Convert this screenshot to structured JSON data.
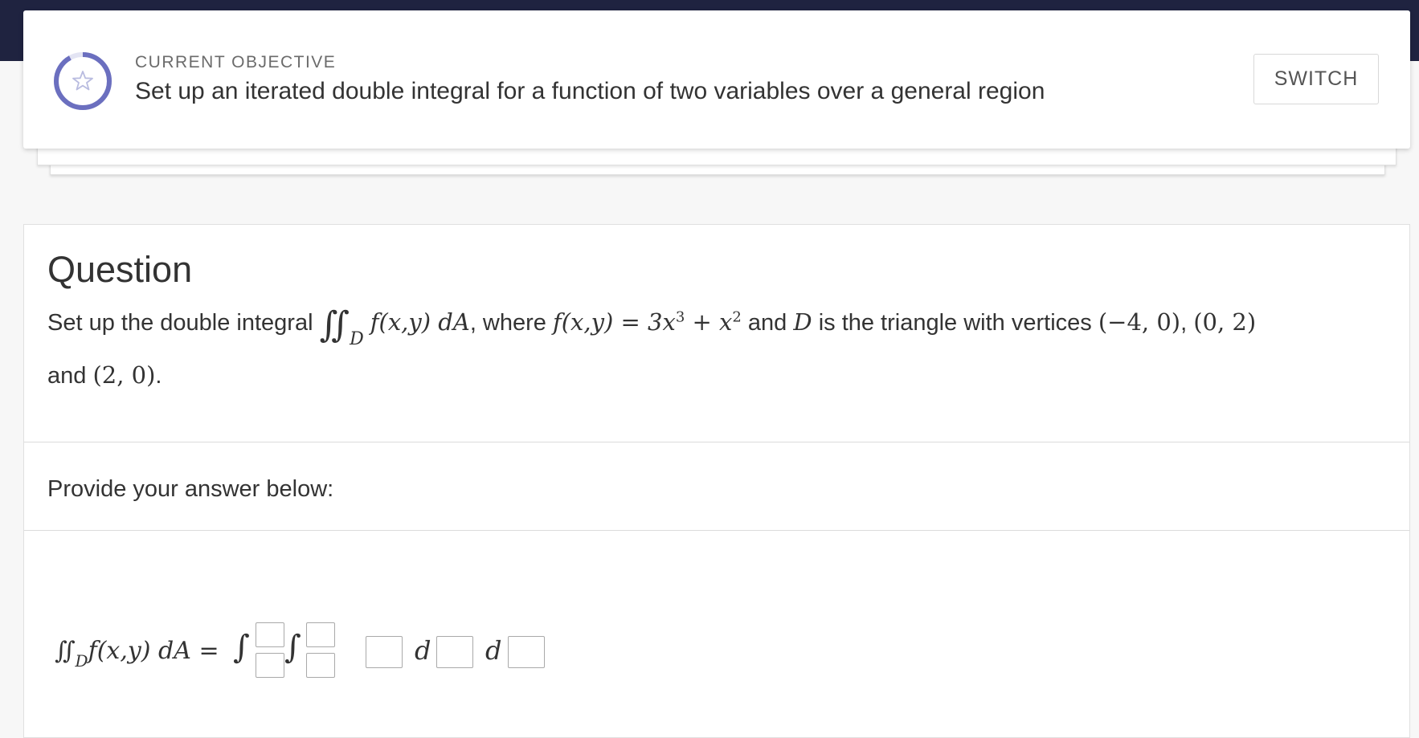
{
  "objective": {
    "label": "CURRENT OBJECTIVE",
    "text": "Set up an iterated double integral for a function of two variables over a general region",
    "switch_label": "SWITCH",
    "icon": "star-icon",
    "ring_color": "#6b6fbf",
    "ring_progress": 0.92
  },
  "question": {
    "heading": "Question",
    "line1_prefix": "Set up the double integral",
    "integral_symbol": "∬",
    "integral_sub": "D",
    "integrand": "f(x,y) dA",
    "where_text": ", where",
    "function_def": "f(x,y) = 3x",
    "exp1": "3",
    "plus_term": " + x",
    "exp2": "2",
    "and_text": "and",
    "region": "D",
    "triangle_text": "is the triangle with vertices",
    "v1": "(−4, 0)",
    "comma": ",",
    "v2": "(0, 2)",
    "line2_and": "and",
    "v3": "(2, 0)",
    "period": "."
  },
  "answer": {
    "prompt": "Provide your answer below:",
    "lhs": "∬",
    "lhs_sub": "D",
    "lhs_rest": "f(x,y) dA =",
    "integral_glyph": "∫",
    "d1": "d",
    "d2": "d"
  }
}
